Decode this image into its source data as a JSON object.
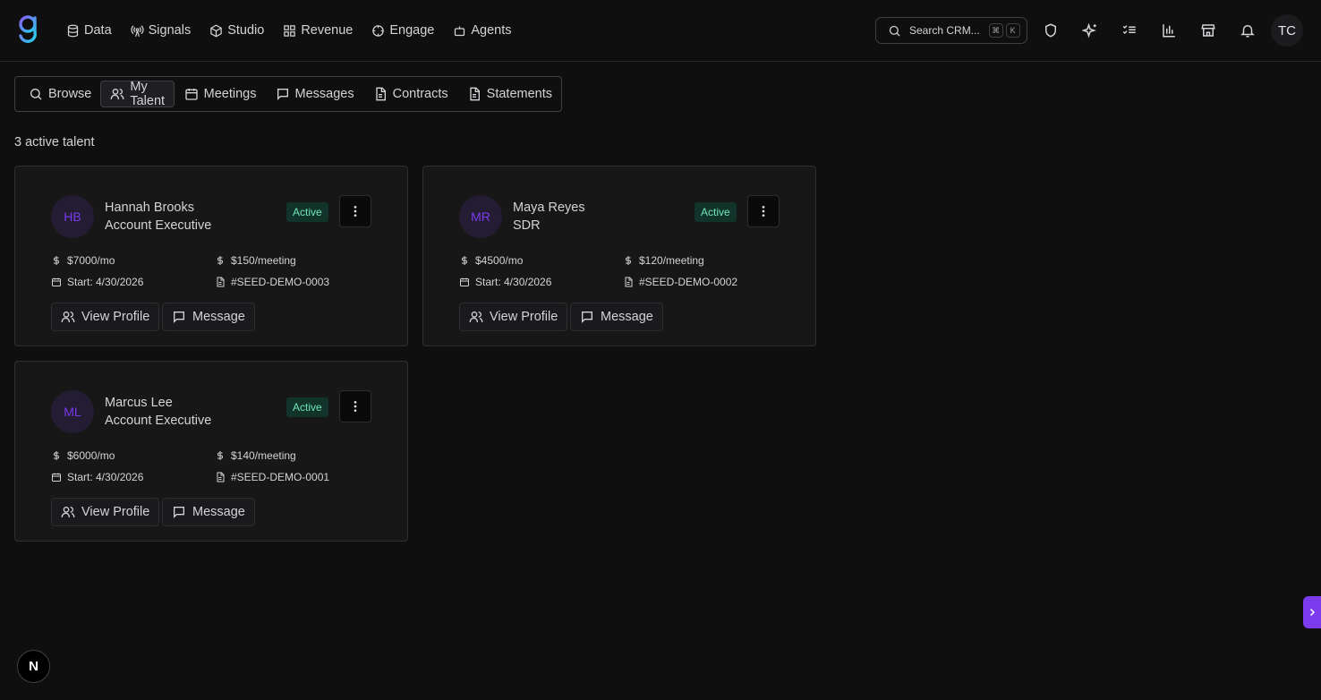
{
  "nav": {
    "items": [
      {
        "label": "Data",
        "icon": "database-icon"
      },
      {
        "label": "Signals",
        "icon": "signal-icon"
      },
      {
        "label": "Studio",
        "icon": "cube-icon"
      },
      {
        "label": "Revenue",
        "icon": "grid-icon"
      },
      {
        "label": "Engage",
        "icon": "target-icon"
      },
      {
        "label": "Agents",
        "icon": "bot-icon"
      }
    ]
  },
  "search": {
    "placeholder": "Search CRM...",
    "kbd_mod": "⌘",
    "kbd_key": "K"
  },
  "user": {
    "initials": "TC"
  },
  "subnav": {
    "items": [
      {
        "label": "Browse",
        "icon": "search-icon"
      },
      {
        "label": "My Talent",
        "icon": "users-icon",
        "active": true
      },
      {
        "label": "Meetings",
        "icon": "calendar-icon"
      },
      {
        "label": "Messages",
        "icon": "message-icon"
      },
      {
        "label": "Contracts",
        "icon": "file-icon"
      },
      {
        "label": "Statements",
        "icon": "file-icon"
      }
    ]
  },
  "summary": {
    "count_text": "3 active talent"
  },
  "talent": [
    {
      "initials": "HB",
      "name": "Hannah Brooks",
      "role": "Account Executive",
      "status": "Active",
      "monthly": "$7000/mo",
      "per_meeting": "$150/meeting",
      "start": "Start: 4/30/2026",
      "contract_id": "#SEED-DEMO-0003",
      "view_label": "View Profile",
      "message_label": "Message"
    },
    {
      "initials": "MR",
      "name": "Maya Reyes",
      "role": "SDR",
      "status": "Active",
      "monthly": "$4500/mo",
      "per_meeting": "$120/meeting",
      "start": "Start: 4/30/2026",
      "contract_id": "#SEED-DEMO-0002",
      "view_label": "View Profile",
      "message_label": "Message"
    },
    {
      "initials": "ML",
      "name": "Marcus Lee",
      "role": "Account Executive",
      "status": "Active",
      "monthly": "$6000/mo",
      "per_meeting": "$140/meeting",
      "start": "Start: 4/30/2026",
      "contract_id": "#SEED-DEMO-0001",
      "view_label": "View Profile",
      "message_label": "Message"
    }
  ],
  "dev_badge": {
    "label": "N"
  },
  "colors": {
    "accent": "#7c3aed",
    "active_badge_bg": "#12332a",
    "active_badge_text": "#6ee7b7",
    "background": "#0f0f0f"
  }
}
